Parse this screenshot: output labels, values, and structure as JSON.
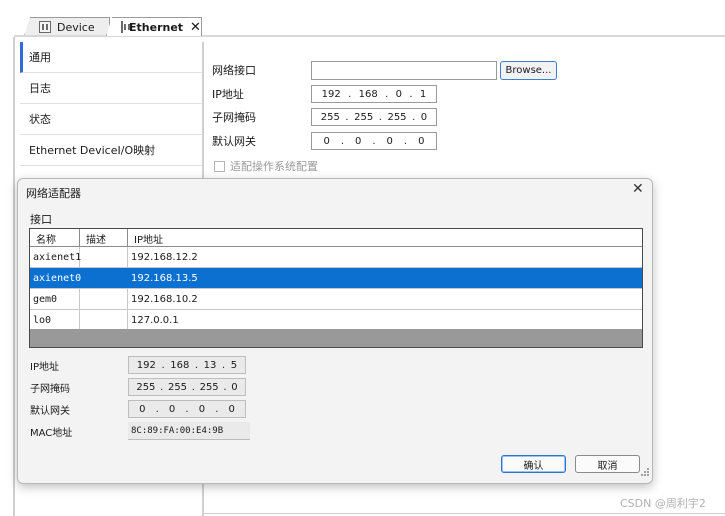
{
  "tabs": [
    {
      "label": "Device",
      "icon": "device-icon"
    },
    {
      "label": "Ethernet",
      "icon": "device-icon",
      "active": true
    }
  ],
  "nav": {
    "items": [
      {
        "label": "通用",
        "selected": true
      },
      {
        "label": "日志"
      },
      {
        "label": "状态"
      },
      {
        "label": "Ethernet DeviceI/O映射"
      }
    ]
  },
  "settings": {
    "interface_label": "网络接口",
    "interface_value": "",
    "browse_label": "Browse...",
    "ip_label": "IP地址",
    "ip": [
      "192",
      "168",
      "0",
      "1"
    ],
    "subnet_label": "子网掩码",
    "subnet": [
      "255",
      "255",
      "255",
      "0"
    ],
    "gateway_label": "默认网关",
    "gateway": [
      "0",
      "0",
      "0",
      "0"
    ],
    "adapt_os_label": "适配操作系统配置",
    "adapt_os_checked": false
  },
  "dialog": {
    "title": "网络适配器",
    "group_label": "接口",
    "columns": [
      "名称",
      "描述",
      "IP地址"
    ],
    "rows": [
      {
        "name": "axienet1",
        "desc": "",
        "ip": "192.168.12.2"
      },
      {
        "name": "axienet0",
        "desc": "",
        "ip": "192.168.13.5",
        "selected": true
      },
      {
        "name": "gem0",
        "desc": "",
        "ip": "192.168.10.2"
      },
      {
        "name": "lo0",
        "desc": "",
        "ip": "127.0.0.1"
      }
    ],
    "ip_label": "IP地址",
    "ip": [
      "192",
      "168",
      "13",
      "5"
    ],
    "subnet_label": "子网掩码",
    "subnet": [
      "255",
      "255",
      "255",
      "0"
    ],
    "gateway_label": "默认网关",
    "gateway": [
      "0",
      "0",
      "0",
      "0"
    ],
    "mac_label": "MAC地址",
    "mac": "8C:89:FA:00:E4:9B",
    "ok_label": "确认",
    "cancel_label": "取消"
  },
  "watermark": "CSDN @周利宇2",
  "colors": {
    "selection": "#0b70d0",
    "accent": "#2d6bd6"
  }
}
